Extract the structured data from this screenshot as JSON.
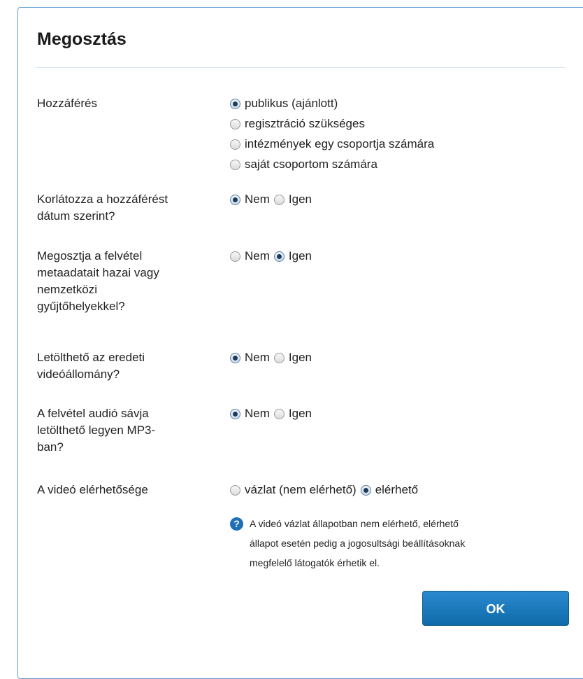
{
  "dialog": {
    "title": "Megosztás",
    "ok_label": "OK"
  },
  "access": {
    "label": "Hozzáférés",
    "options": [
      {
        "label": "publikus (ajánlott)",
        "checked": true
      },
      {
        "label": "regisztráció szükséges",
        "checked": false
      },
      {
        "label": "intézmények egy csoportja számára",
        "checked": false
      },
      {
        "label": "saját csoportom számára",
        "checked": false
      }
    ]
  },
  "date_restrict": {
    "label_line1": "Korlátozza a hozzáférést",
    "label_line2": "dátum szerint?",
    "no": "Nem",
    "yes": "Igen",
    "selected": "Nem"
  },
  "share_metadata": {
    "label_lines": [
      "Megosztja a felvétel",
      "metaadatait hazai vagy",
      "nemzetközi",
      "gyűjtőhelyekkel?"
    ],
    "no": "Nem",
    "yes": "Igen",
    "selected": "Igen"
  },
  "download_original": {
    "label_lines": [
      "Letölthető az eredeti",
      "videóállomány?"
    ],
    "no": "Nem",
    "yes": "Igen",
    "selected": "Nem"
  },
  "audio_mp3": {
    "label_lines": [
      "A felvétel audió sávja",
      "letölthető legyen MP3-",
      "ban?"
    ],
    "no": "Nem",
    "yes": "Igen",
    "selected": "Nem"
  },
  "availability": {
    "label": "A videó elérhetősége",
    "draft": "vázlat (nem elérhető)",
    "available": "elérhető",
    "selected": "elérhető",
    "help_lines": [
      "A videó vázlat állapotban nem elérhető, elérhető",
      "állapot esetén pedig a jogosultsági beállításoknak",
      "megfelelő látogatók érhetik el."
    ]
  }
}
